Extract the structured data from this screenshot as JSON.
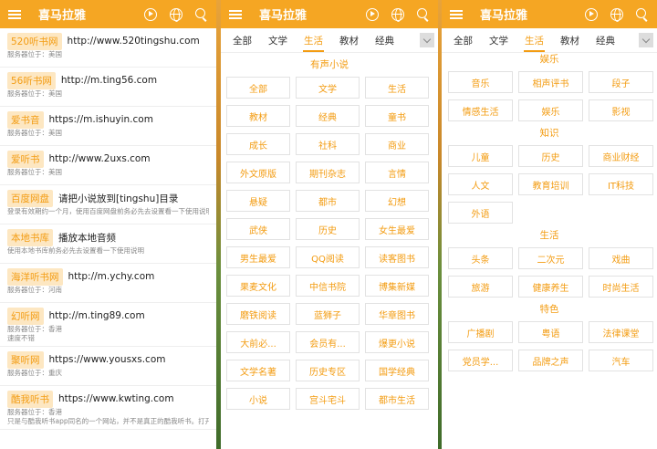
{
  "app_title": "喜马拉雅",
  "panel1": {
    "sites": [
      {
        "tag": "520听书网",
        "url": "http://www.520tingshu.com",
        "info": [
          "服务器位于：美国"
        ]
      },
      {
        "tag": "56听书网",
        "url": "http://m.ting56.com",
        "info": [
          "服务器位于：美国"
        ]
      },
      {
        "tag": "爱书音",
        "url": "https://m.ishuyin.com",
        "info": [
          "服务器位于：美国"
        ]
      },
      {
        "tag": "爱听书",
        "url": "http://www.2uxs.com",
        "info": [
          "服务器位于：美国"
        ]
      },
      {
        "tag": "百度网盘",
        "url": "请把小说放到[tingshu]目录",
        "info": [
          "登录有效期约一个月，使用百度网盘前务必先去设置看一下使用说明"
        ]
      },
      {
        "tag": "本地书库",
        "url": "播放本地音频",
        "info": [
          "使用本地书库前务必先去设置看一下使用说明"
        ]
      },
      {
        "tag": "海洋听书网",
        "url": "http://m.ychy.com",
        "info": [
          "服务器位于：河南"
        ]
      },
      {
        "tag": "幻听网",
        "url": "http://m.ting89.com",
        "info": [
          "服务器位于：香港",
          "速度不错"
        ]
      },
      {
        "tag": "聚听网",
        "url": "https://www.yousxs.com",
        "info": [
          "服务器位于：重庆"
        ]
      },
      {
        "tag": "酷我听书",
        "url": "https://www.kwting.com",
        "info": [
          "服务器位于：香港",
          "只是与酷我听书app同名的一个网站，并不是真正的酷我听书。打开速度较慢。"
        ]
      }
    ]
  },
  "tabs": [
    "全部",
    "文学",
    "生活",
    "教材",
    "经典"
  ],
  "active_tab": "生活",
  "panel2": {
    "section": "有声小说",
    "items": [
      "全部",
      "文学",
      "生活",
      "教材",
      "经典",
      "童书",
      "成长",
      "社科",
      "商业",
      "外文原版",
      "期刊杂志",
      "言情",
      "悬疑",
      "都市",
      "幻想",
      "武侠",
      "历史",
      "女生最爱",
      "男生最爱",
      "QQ阅读",
      "读客图书",
      "果麦文化",
      "中信书院",
      "博集新媒",
      "磨铁阅读",
      "蓝狮子",
      "华章图书",
      "大前必...",
      "会员有...",
      "爆更小说",
      "文学名著",
      "历史专区",
      "国学经典",
      "小说",
      "宫斗宅斗",
      "都市生活"
    ]
  },
  "panel3": {
    "sections": [
      {
        "title": "娱乐",
        "items": [
          "音乐",
          "相声评书",
          "段子",
          "情感生活",
          "娱乐",
          "影视"
        ]
      },
      {
        "title": "知识",
        "items": [
          "儿童",
          "历史",
          "商业财经",
          "人文",
          "教育培训",
          "IT科技",
          "外语"
        ]
      },
      {
        "title": "生活",
        "items": [
          "头条",
          "二次元",
          "戏曲",
          "旅游",
          "健康养生",
          "时尚生活"
        ]
      },
      {
        "title": "特色",
        "items": [
          "广播剧",
          "粤语",
          "法律课堂",
          "党员学...",
          "品牌之声",
          "汽车"
        ]
      }
    ]
  }
}
